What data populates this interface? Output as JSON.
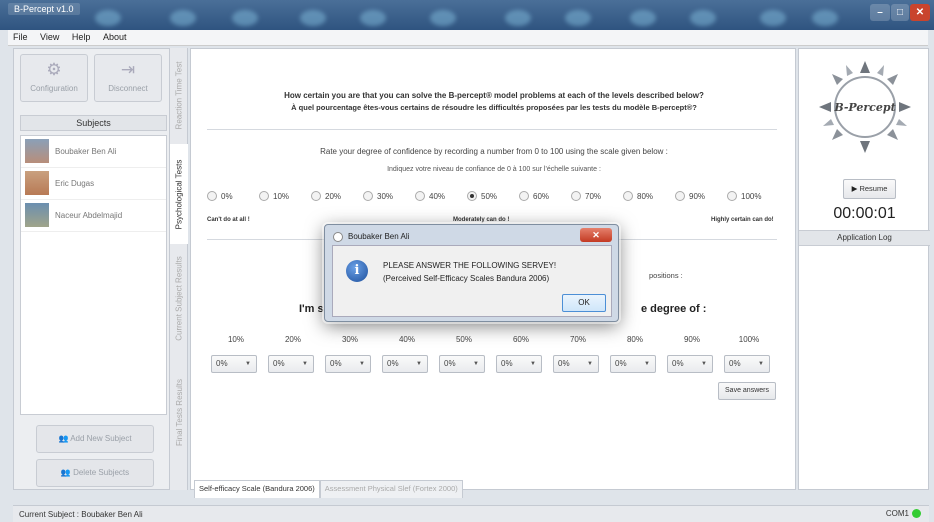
{
  "window": {
    "title": "B-Percept v1.0",
    "minimize": "–",
    "maximize": "□",
    "close": "✕"
  },
  "menu": [
    "File",
    "View",
    "Help",
    "About"
  ],
  "toolbar": {
    "configuration": "Configuration",
    "disconnect": "Disconnect"
  },
  "subjects": {
    "header": "Subjects",
    "items": [
      "Boubaker Ben Ali",
      "Eric Dugas",
      "Naceur Abdelmajid"
    ],
    "add_button": "Add New Subject",
    "delete_button": "Delete Subjects"
  },
  "side_tabs": [
    "Reaction Time Test",
    "Psychological Tests",
    "Current Subject Results",
    "Final Tests Results"
  ],
  "question": {
    "en": "How certain you are that you can solve the B-percept® model problems at each of the levels described below?",
    "fr": "À quel pourcentage êtes-vous certains de résoudre les difficultés proposées par les tests du modèle B-percept®?"
  },
  "rating": {
    "en": "Rate your degree of confidence by recording a number from 0 to 100 using the scale given below :",
    "fr": "Indiquez votre niveau de confiance de 0 à 100 sur l'échelle suivante :",
    "options": [
      "0%",
      "10%",
      "20%",
      "30%",
      "40%",
      "50%",
      "60%",
      "70%",
      "80%",
      "90%",
      "100%"
    ],
    "selected": "50%",
    "scale_low": "Can't do at all !",
    "scale_mid": "Moderately can do !",
    "scale_high": "Highly certain can do!"
  },
  "section2": {
    "positions_text": "positions :",
    "im_sure": "I'm su",
    "degree_of": "e degree of :",
    "levels": [
      "10%",
      "20%",
      "30%",
      "40%",
      "50%",
      "60%",
      "70%",
      "80%",
      "90%",
      "100%"
    ],
    "selects": [
      "0%",
      "0%",
      "0%",
      "0%",
      "0%",
      "0%",
      "0%",
      "0%",
      "0%",
      "0%"
    ],
    "save_button": "Save answers"
  },
  "bottom_tabs": [
    "Self-efficacy Scale (Bandura 2006)",
    "Assessment Physical Slef (Fortex 2000)"
  ],
  "right_panel": {
    "logo_text": "B-Percept",
    "resume": "Resume",
    "timer": "00:00:01",
    "log_header": "Application Log"
  },
  "status": {
    "current_subject": "Current Subject : Boubaker Ben Ali",
    "port": "COM1"
  },
  "dialog": {
    "title": "Boubaker Ben Ali",
    "line1": "PLEASE ANSWER THE FOLLOWING SERVEY!",
    "line2": "(Perceived Self-Efficacy Scales Bandura 2006)",
    "ok": "OK",
    "close": "✕",
    "info_glyph": "i"
  },
  "colors": {
    "titlebar": "#3a5f8a",
    "dialog_frame": "#cfd9e6",
    "status_dot": "#33cc33",
    "ok_border": "#4c8fd6"
  }
}
